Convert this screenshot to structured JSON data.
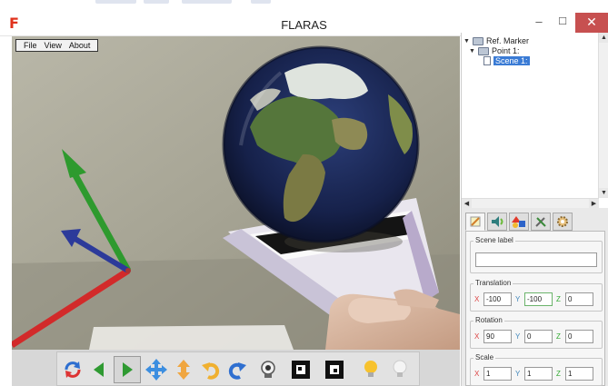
{
  "window": {
    "title": "FLARAS",
    "logo_glyph": "F",
    "minimize_glyph": "–",
    "maximize_glyph": "☐",
    "close_glyph": "✕"
  },
  "viewport": {
    "menu": [
      "File",
      "View",
      "About"
    ]
  },
  "toolbar": {
    "buttons": [
      {
        "name": "refresh-icon",
        "selected": false
      },
      {
        "name": "arrow-left-icon",
        "selected": false
      },
      {
        "name": "arrow-right-icon",
        "selected": true
      },
      {
        "name": "move-icon",
        "selected": false
      },
      {
        "name": "move-vertical-icon",
        "selected": false
      },
      {
        "name": "rotate-left-icon",
        "selected": false
      },
      {
        "name": "rotate-right-icon",
        "selected": false
      },
      {
        "name": "webcam-icon",
        "selected": false
      },
      {
        "name": "marker-icon",
        "selected": false
      },
      {
        "name": "marker-alt-icon",
        "selected": false
      },
      {
        "name": "light-on-icon",
        "selected": false
      },
      {
        "name": "light-off-icon",
        "selected": false
      }
    ]
  },
  "tree": {
    "items": [
      {
        "label": "Ref. Marker",
        "type": "folder",
        "level": 0,
        "expanded": true
      },
      {
        "label": "Point 1:",
        "type": "folder",
        "level": 1,
        "expanded": true
      },
      {
        "label": "Scene 1:",
        "type": "scene",
        "level": 2,
        "selected": true
      }
    ]
  },
  "properties": {
    "tabs": [
      "edit-icon",
      "sound-icon",
      "shapes-icon",
      "tools-icon",
      "settings-icon"
    ],
    "scene_label": {
      "label": "Scene label",
      "value": ""
    },
    "translation": {
      "label": "Translation",
      "x": "-100",
      "y": "-100",
      "z": "0"
    },
    "rotation": {
      "label": "Rotation",
      "x": "90",
      "y": "0",
      "z": "0"
    },
    "scale": {
      "label": "Scale",
      "x": "1",
      "y": "1",
      "z": "1"
    }
  },
  "colors": {
    "close_button": "#c75050",
    "axis_x": "#d22a2a",
    "axis_y": "#2e9a2e",
    "axis_z": "#2c3a9a",
    "selection": "#3a7bd5"
  }
}
